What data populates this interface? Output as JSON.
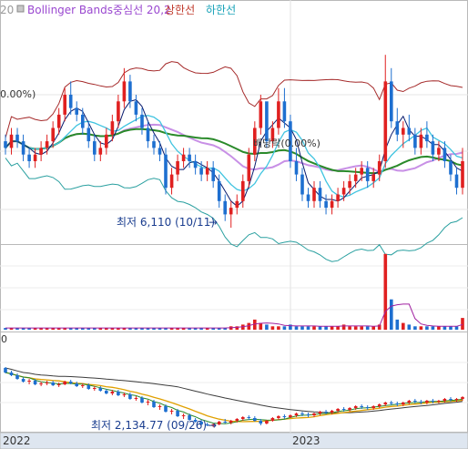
{
  "legend": [
    {
      "text": "20",
      "color": "#9a9a9a"
    },
    {
      "text": "Bollinger Bands중심선 20,2",
      "color": "#9a48d0"
    },
    {
      "text": "상한선",
      "color": "#c0392b"
    },
    {
      "text": "하한선",
      "color": "#17a2b8"
    }
  ],
  "colors": {
    "up": "#e02020",
    "down": "#1e6fd0",
    "ma_long": "#2a8a2a",
    "bb_mid": "#c890e6",
    "bb_upper": "#a52a2a",
    "bb_lower": "#2aa0a0",
    "ma_short": "#40c4e0",
    "ma_mid": "#0a1c6e",
    "vol_up": "#e02020",
    "vol_down": "#1e6fd0",
    "vol_ma": "#a020a0",
    "index_ma_long": "#3c3c3c",
    "index_ma_short": "#e0a000"
  },
  "annotations": {
    "price_low": "최저 6,110 (10/11)",
    "index_low": "최저 2,134.77 (09/26)",
    "dividend": "배당락(0.00%)",
    "left_label": "0.00%)",
    "index_axis_label": "0"
  },
  "x_axis": [
    "2022",
    "2023"
  ],
  "chart_data": {
    "type": "candlestick",
    "price": {
      "low_value": 6110,
      "low_date": "10/11",
      "candles": [
        [
          13,
          14,
          11,
          12
        ],
        [
          12,
          15,
          11,
          14
        ],
        [
          14,
          15,
          12,
          13
        ],
        [
          13,
          14,
          10,
          11
        ],
        [
          11,
          12,
          9,
          10
        ],
        [
          10,
          12,
          9,
          11
        ],
        [
          11,
          13,
          10,
          12
        ],
        [
          12,
          14,
          11,
          13
        ],
        [
          13,
          16,
          12,
          15
        ],
        [
          15,
          18,
          14,
          17
        ],
        [
          17,
          21,
          16,
          20
        ],
        [
          20,
          22,
          17,
          18
        ],
        [
          18,
          19,
          16,
          17
        ],
        [
          17,
          18,
          14,
          15
        ],
        [
          15,
          16,
          12,
          13
        ],
        [
          13,
          14,
          10,
          11
        ],
        [
          11,
          13,
          10,
          12
        ],
        [
          12,
          15,
          11,
          14
        ],
        [
          14,
          17,
          13,
          16
        ],
        [
          16,
          20,
          15,
          19
        ],
        [
          19,
          24,
          18,
          22
        ],
        [
          22,
          23,
          18,
          19
        ],
        [
          19,
          20,
          16,
          17
        ],
        [
          17,
          18,
          14,
          15
        ],
        [
          15,
          16,
          12,
          13
        ],
        [
          13,
          14,
          11,
          12
        ],
        [
          12,
          13,
          10,
          11
        ],
        [
          11,
          12,
          5,
          6
        ],
        [
          6,
          9,
          5,
          8
        ],
        [
          8,
          11,
          7,
          10
        ],
        [
          10,
          12,
          9,
          11
        ],
        [
          11,
          12,
          9,
          10
        ],
        [
          10,
          11,
          8,
          9
        ],
        [
          9,
          10,
          7,
          8
        ],
        [
          8,
          10,
          7,
          9
        ],
        [
          9,
          10,
          6,
          7
        ],
        [
          7,
          8,
          3,
          4
        ],
        [
          4,
          5,
          1,
          2
        ],
        [
          2,
          4,
          0,
          3
        ],
        [
          3,
          5,
          2,
          4
        ],
        [
          4,
          8,
          3,
          7
        ],
        [
          7,
          12,
          6,
          11
        ],
        [
          11,
          16,
          10,
          15
        ],
        [
          15,
          20,
          14,
          19
        ],
        [
          19,
          18,
          12,
          13
        ],
        [
          13,
          16,
          12,
          15
        ],
        [
          15,
          21,
          14,
          19
        ],
        [
          19,
          21,
          15,
          16
        ],
        [
          16,
          17,
          9,
          10
        ],
        [
          10,
          12,
          7,
          8
        ],
        [
          8,
          9,
          4,
          5
        ],
        [
          5,
          6,
          3,
          4
        ],
        [
          4,
          7,
          3,
          6
        ],
        [
          6,
          7,
          3,
          4
        ],
        [
          4,
          5,
          2,
          3
        ],
        [
          3,
          5,
          2,
          4
        ],
        [
          4,
          6,
          3,
          5
        ],
        [
          5,
          7,
          4,
          6
        ],
        [
          6,
          8,
          5,
          7
        ],
        [
          7,
          9,
          6,
          8
        ],
        [
          8,
          10,
          7,
          9
        ],
        [
          9,
          10,
          6,
          7
        ],
        [
          7,
          9,
          6,
          8
        ],
        [
          8,
          11,
          7,
          10
        ],
        [
          10,
          26,
          9,
          22
        ],
        [
          22,
          24,
          15,
          16
        ],
        [
          16,
          18,
          13,
          14
        ],
        [
          14,
          16,
          12,
          15
        ],
        [
          15,
          17,
          13,
          14
        ],
        [
          14,
          15,
          11,
          12
        ],
        [
          12,
          15,
          11,
          14
        ],
        [
          14,
          16,
          12,
          13
        ],
        [
          13,
          14,
          10,
          11
        ],
        [
          11,
          13,
          10,
          12
        ],
        [
          12,
          13,
          9,
          10
        ],
        [
          10,
          11,
          7,
          8
        ],
        [
          8,
          9,
          5,
          6
        ],
        [
          6,
          12,
          5,
          10
        ]
      ]
    },
    "volume": {
      "values": [
        1,
        1,
        1,
        1,
        1,
        1,
        1,
        1,
        1,
        1,
        1,
        1,
        1,
        1,
        1,
        1,
        1,
        1,
        1,
        1,
        1,
        1,
        1,
        1,
        1,
        1,
        1,
        1,
        1,
        1,
        1,
        1,
        1,
        1,
        1,
        1,
        1,
        1,
        2,
        2,
        3,
        4,
        6,
        4,
        3,
        2,
        2,
        2,
        3,
        2,
        2,
        2,
        2,
        2,
        2,
        2,
        2,
        3,
        2,
        2,
        2,
        2,
        2,
        3,
        45,
        18,
        6,
        4,
        3,
        2,
        2,
        2,
        2,
        2,
        2,
        2,
        2,
        7
      ]
    },
    "index": {
      "low_value": "2,134.77",
      "low_date": "09/26",
      "candles": [
        [
          66,
          67,
          60,
          61
        ],
        [
          61,
          63,
          57,
          58
        ],
        [
          58,
          60,
          53,
          54
        ],
        [
          54,
          56,
          50,
          51
        ],
        [
          51,
          54,
          48,
          52
        ],
        [
          52,
          54,
          47,
          48
        ],
        [
          48,
          51,
          46,
          49
        ],
        [
          49,
          52,
          47,
          50
        ],
        [
          50,
          52,
          46,
          47
        ],
        [
          47,
          50,
          45,
          48
        ],
        [
          48,
          52,
          47,
          51
        ],
        [
          51,
          53,
          48,
          49
        ],
        [
          49,
          51,
          45,
          46
        ],
        [
          46,
          49,
          44,
          47
        ],
        [
          47,
          49,
          42,
          43
        ],
        [
          43,
          46,
          41,
          44
        ],
        [
          44,
          46,
          40,
          41
        ],
        [
          41,
          43,
          37,
          38
        ],
        [
          38,
          42,
          36,
          40
        ],
        [
          40,
          42,
          35,
          36
        ],
        [
          36,
          39,
          34,
          37
        ],
        [
          37,
          39,
          31,
          32
        ],
        [
          32,
          35,
          30,
          33
        ],
        [
          33,
          35,
          27,
          28
        ],
        [
          28,
          31,
          25,
          29
        ],
        [
          29,
          31,
          22,
          23
        ],
        [
          23,
          26,
          20,
          24
        ],
        [
          24,
          26,
          17,
          18
        ],
        [
          18,
          21,
          15,
          19
        ],
        [
          19,
          21,
          12,
          13
        ],
        [
          13,
          16,
          10,
          14
        ],
        [
          14,
          16,
          8,
          9
        ],
        [
          9,
          11,
          6,
          7
        ],
        [
          7,
          9,
          3,
          4
        ],
        [
          4,
          6,
          2,
          3
        ],
        [
          3,
          5,
          1,
          4
        ],
        [
          4,
          8,
          3,
          7
        ],
        [
          7,
          10,
          5,
          6
        ],
        [
          6,
          9,
          4,
          8
        ],
        [
          8,
          11,
          6,
          10
        ],
        [
          10,
          13,
          8,
          12
        ],
        [
          12,
          14,
          9,
          11
        ],
        [
          11,
          13,
          7,
          8
        ],
        [
          8,
          10,
          3,
          5
        ],
        [
          5,
          9,
          4,
          8
        ],
        [
          8,
          12,
          7,
          11
        ],
        [
          11,
          14,
          9,
          13
        ],
        [
          13,
          15,
          10,
          12
        ],
        [
          12,
          15,
          11,
          14
        ],
        [
          14,
          17,
          12,
          16
        ],
        [
          16,
          18,
          13,
          15
        ],
        [
          15,
          17,
          12,
          14
        ],
        [
          14,
          17,
          12,
          16
        ],
        [
          16,
          19,
          14,
          18
        ],
        [
          18,
          20,
          15,
          17
        ],
        [
          17,
          20,
          15,
          19
        ],
        [
          19,
          22,
          17,
          21
        ],
        [
          21,
          23,
          18,
          20
        ],
        [
          20,
          23,
          18,
          22
        ],
        [
          22,
          25,
          20,
          24
        ],
        [
          24,
          26,
          21,
          23
        ],
        [
          23,
          25,
          20,
          22
        ],
        [
          22,
          25,
          20,
          24
        ],
        [
          24,
          27,
          22,
          26
        ],
        [
          26,
          29,
          24,
          28
        ],
        [
          28,
          30,
          25,
          27
        ],
        [
          27,
          29,
          24,
          26
        ],
        [
          26,
          29,
          24,
          28
        ],
        [
          28,
          31,
          26,
          30
        ],
        [
          30,
          32,
          27,
          29
        ],
        [
          29,
          31,
          26,
          28
        ],
        [
          28,
          31,
          26,
          30
        ],
        [
          30,
          32,
          27,
          29
        ],
        [
          29,
          31,
          27,
          30
        ],
        [
          30,
          33,
          28,
          32
        ],
        [
          32,
          34,
          29,
          31
        ],
        [
          31,
          33,
          29,
          32
        ],
        [
          32,
          35,
          30,
          34
        ]
      ]
    }
  }
}
